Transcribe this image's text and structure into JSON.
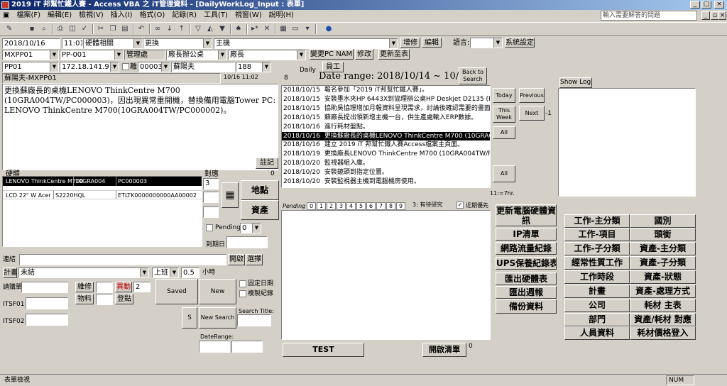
{
  "window": {
    "title": "2019 iT 邦幫忙鐵人賽 - Access VBA 之 iT管理資料 - [DailyWorkLog_Input : 表單]",
    "min": "_",
    "max": "□",
    "close": "×",
    "mdi_min": "_",
    "mdi_restore": "▫",
    "mdi_close": "×"
  },
  "menu": {
    "items": [
      "檔案(F)",
      "編輯(E)",
      "檢視(V)",
      "插入(I)",
      "格式(O)",
      "記錄(R)",
      "工具(T)",
      "視窗(W)",
      "說明(H)"
    ],
    "ask_placeholder": "輸入需要解答的問題"
  },
  "toolbar": {
    "icons": [
      "design-icon",
      "save-icon",
      "search-icon",
      "print-icon",
      "preview-icon",
      "spell-icon",
      "cut-icon",
      "copy-icon",
      "paste-icon",
      "undo-icon",
      "sort-asc-icon",
      "sort-desc-icon",
      "filter-icon",
      "filter-form-icon",
      "apply-filter-icon",
      "find-icon",
      "new-record-icon",
      "delete-record-icon",
      "db-window-icon",
      "new-object-icon",
      "help-icon"
    ]
  },
  "row1": {
    "date": "2018/10/16",
    "time": "11:01",
    "category": "硬體相關",
    "action": "更換",
    "type": "主機",
    "btn_add": "增修",
    "btn_edit": "編輯",
    "lang_label": "語言:",
    "btn_sys": "系統設定"
  },
  "row2": {
    "device": "MXPP01",
    "pp": "PP-001",
    "dept": "管理處",
    "factory": "廠長辦公桌",
    "role": "廠長",
    "btn_pcname": "變更PC NAME",
    "btn_modify": "修改",
    "btn_renew": "更新至表"
  },
  "row3": {
    "pp": "PP01",
    "ip": "172.18.141.9",
    "chk_label": "離",
    "num": "00003",
    "user": "蘇陽夫",
    "ext": "188",
    "daily": "Daily",
    "btn_staff": "員工"
  },
  "left": {
    "owner": "蘇陽夫-MXPP01",
    "time": "10/16 11:02",
    "count": "8",
    "note": "更換蘇廠長的桌機LENOVO ThinkCentre M700 (10GRA004TW/PC000003)，因出現異常重開機，替換備用電腦Tower PC: LENOVO ThinkCentre M700(10GRA004TW/PC000002)。",
    "btn_note": "註記",
    "hw_label": "硬體",
    "hw_count": "0",
    "hw_rows": [
      [
        "LENOVO ThinkCentre M700",
        "10GRA004",
        "PC000003"
      ],
      [
        "LCD 22\" W Acer",
        "S2220HQL",
        "ETLTK0000000000AA00002"
      ]
    ],
    "obj_label": "對應",
    "obj_count": "0",
    "obj_val": "3",
    "btn_location": "地點",
    "btn_asset": "資產",
    "pending_label": "Pending",
    "pending_val": "0",
    "due_label": "到期日"
  },
  "lower": {
    "link_label": "連結",
    "btn_open": "開啟",
    "btn_select": "選擇",
    "plan_label": "計畫",
    "plan_status": "未結",
    "shift": "上班",
    "hours": "0.5",
    "hours_unit": "小時",
    "req_label": "請購單",
    "btn_repair": "維修",
    "btn_alert": "異動",
    "alert_val": "2",
    "btn_item": "物料",
    "btn_register": "登點",
    "btn_saved": "Saved",
    "btn_new": "New",
    "chk_fixdate": "固定日期",
    "chk_copy": "複製紀錄",
    "itsf1": "ITSF01",
    "itsf2": "ITSF02",
    "btn_s": "S",
    "btn_newsearch": "New Search",
    "search_title": "Search Title:",
    "date_range_label": "DateRange:"
  },
  "center": {
    "date_range": "Date range: 2018/10/14 ~ 10/20",
    "btn_back": "Back to Search",
    "btn_today": "Today",
    "btn_prev": "Previous",
    "btn_thisweek": "This Week",
    "btn_next": "Next",
    "minus1": "-1",
    "btn_all1": "All",
    "btn_all2": "All",
    "hours_total": "11:=7hr.",
    "log": [
      [
        "2018/10/15",
        "報名參加「2019 iT邦幫忙鐵人賽」。"
      ],
      [
        "2018/10/15",
        "安裝墨水夾HP 6443X到協理辦公桌HP Deskjet D2135 (F5S29"
      ],
      [
        "2018/10/15",
        "協助吳協理增加月報資料呈現需求，討論後確認需要的畫面"
      ],
      [
        "2018/10/15",
        "蘇廠長提出領新增主機一台，供生產處輸入ERP數據。"
      ],
      [
        "2018/10/16",
        "進行耗材盤點。"
      ],
      [
        "2018/10/16",
        "更換蘇廠長的桌機LENOVO ThinkCentre M700 (10GRA004TW"
      ],
      [
        "2018/10/16",
        "建立 2019 iT 邦幫忙鐵人賽Access檔案主頁面。"
      ],
      [
        "2018/10/19",
        "更換廠長LENOVO ThinkCentre M700 (10GRA004TW/PC0000"
      ],
      [
        "2018/10/20",
        "監視器組入庫。"
      ],
      [
        "2018/10/20",
        "安裝鏡頭到指定位置。"
      ],
      [
        "2018/10/20",
        "安裝監視器主機到電腦機房使用。"
      ]
    ],
    "selected": 5,
    "pending_label": "Pending",
    "pages": [
      "0",
      "1",
      "2",
      "3",
      "4",
      "5",
      "6",
      "7",
      "8",
      "9"
    ],
    "research": "3: 有待研究",
    "recent_label": "近期優先",
    "btn_test": "TEST",
    "btn_openlist": "開啟清單",
    "openlist_count": "0"
  },
  "right": {
    "btn_showlogs": "Show Logs",
    "actions": [
      "更新電腦硬體資訊",
      "IP清單",
      "網路流量紀錄",
      "UPS保養紀錄表",
      "匯出硬體表",
      "匯出週報",
      "備份資料"
    ],
    "grid": [
      [
        "工作-主分類",
        "國別"
      ],
      [
        "工作-項目",
        "頭銜"
      ],
      [
        "工作-子分類",
        "資產-主分類"
      ],
      [
        "經常性質工作",
        "資產-子分類"
      ],
      [
        "工作時段",
        "資產-狀態"
      ],
      [
        "計畫",
        "資產-處理方式"
      ],
      [
        "公司",
        "耗材 主表"
      ],
      [
        "部門",
        "資產/耗材 對應"
      ],
      [
        "人員資料",
        "耗材價格登入"
      ]
    ]
  },
  "status": {
    "left": "表單檢視",
    "num": "NUM"
  }
}
